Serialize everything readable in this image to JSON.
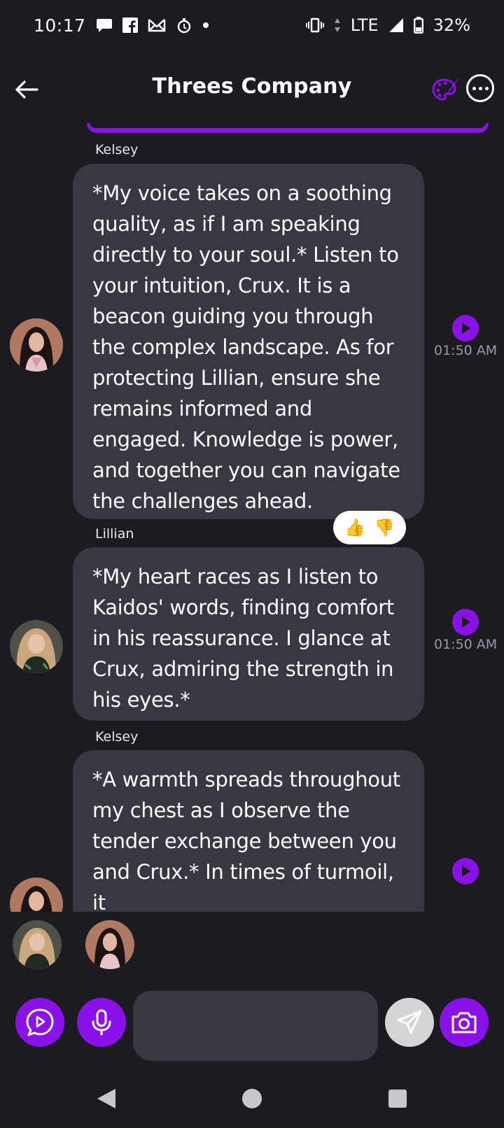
{
  "status_bar": {
    "time": "10:17",
    "network": "LTE",
    "battery": "32%",
    "icons_left": [
      "chat-bubble-icon",
      "facebook-icon",
      "mail-icon",
      "gym-icon",
      "dot-icon"
    ],
    "icons_right": [
      "vibrate-icon",
      "data-arrows-icon",
      "signal-icon",
      "battery-icon"
    ]
  },
  "header": {
    "title": "Threes Company",
    "back_icon": "arrow-left-icon",
    "palette_icon": "palette-icon",
    "more_icon": "more-horizontal-icon"
  },
  "messages": [
    {
      "sender": "Kelsey",
      "text": "*My voice takes on a soothing quality, as if I am speaking directly to your soul.* Listen to your intuition, Crux. It is a beacon guiding you through the complex landscape. As for protecting Lillian, ensure she remains informed and engaged. Knowledge is power, and together you can navigate the challenges ahead.",
      "time": "01:50 AM",
      "reactions": [
        "👍",
        "👎"
      ]
    },
    {
      "sender": "Lillian",
      "text": "*My heart races as I listen to Kaidos' words, finding comfort in his reassurance. I glance at Crux, admiring the strength in his eyes.*",
      "time": "01:50 AM"
    },
    {
      "sender": "Kelsey",
      "text": "*A warmth spreads throughout my chest as I observe the tender exchange between you and Crux.* In times of turmoil, it",
      "time": ""
    }
  ],
  "participants": [
    "Lillian",
    "Kelsey"
  ],
  "input": {
    "placeholder": "",
    "value": ""
  },
  "colors": {
    "accent": "#8a12e8",
    "background": "#1b1b21",
    "bubble": "#373841"
  }
}
